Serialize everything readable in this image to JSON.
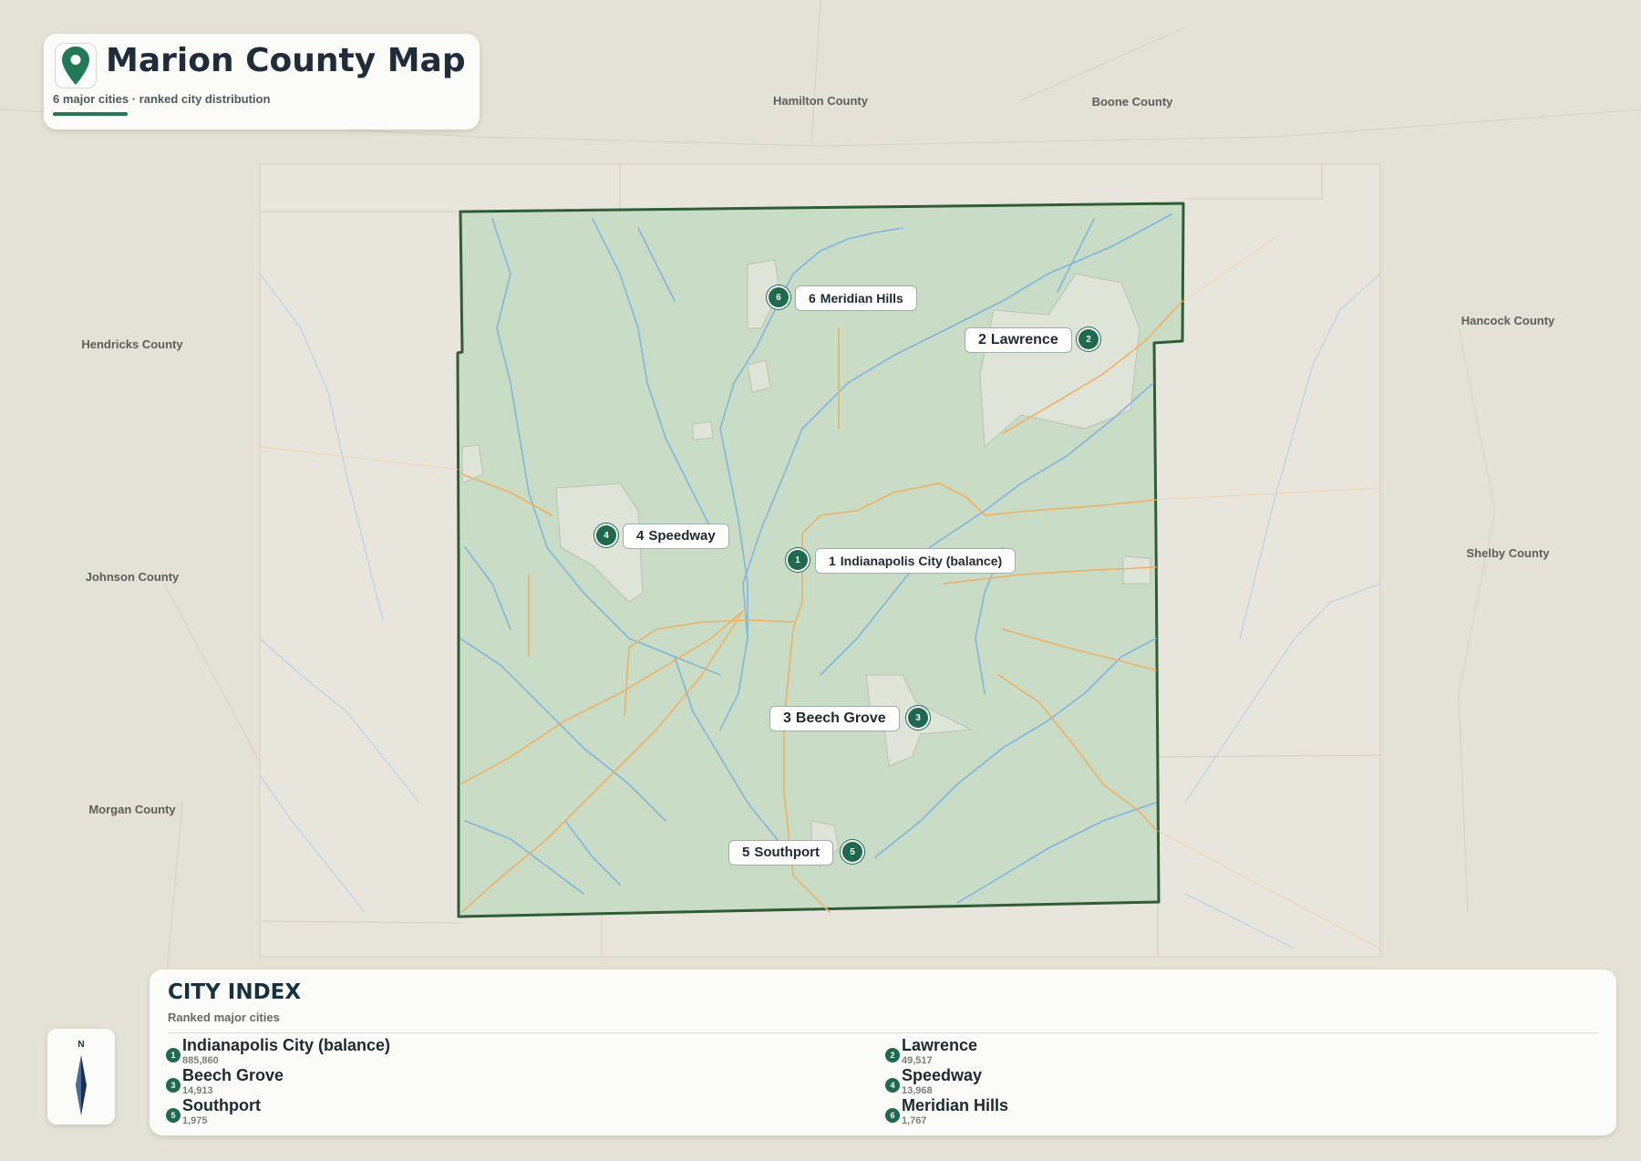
{
  "map": {
    "title": "Marion County Map",
    "subtitle": "6 major cities · ranked city distribution",
    "accent_color": "#1f7a55",
    "county_fill": "#c9dcc5",
    "county_border": "#2f5e36",
    "river_color": "#7fb6df",
    "road_color": "#f0b060",
    "neighbors": [
      {
        "name": "Hamilton County"
      },
      {
        "name": "Boone County"
      },
      {
        "name": "Hendricks County"
      },
      {
        "name": "Hancock County"
      },
      {
        "name": "Shelby County"
      },
      {
        "name": "Johnson County"
      },
      {
        "name": "Morgan County"
      }
    ],
    "cities": [
      {
        "rank": "1",
        "name": "Indianapolis City (balance)",
        "population": "885,860"
      },
      {
        "rank": "2",
        "name": "Lawrence",
        "population": "49,517"
      },
      {
        "rank": "3",
        "name": "Beech Grove",
        "population": "14,913"
      },
      {
        "rank": "4",
        "name": "Speedway",
        "population": "13,968"
      },
      {
        "rank": "5",
        "name": "Southport",
        "population": "1,975"
      },
      {
        "rank": "6",
        "name": "Meridian Hills",
        "population": "1,767"
      }
    ]
  },
  "compass": {
    "label": "N",
    "icon": "north-arrow-icon"
  },
  "index": {
    "title": "CITY INDEX",
    "subtitle": "Ranked major cities"
  }
}
